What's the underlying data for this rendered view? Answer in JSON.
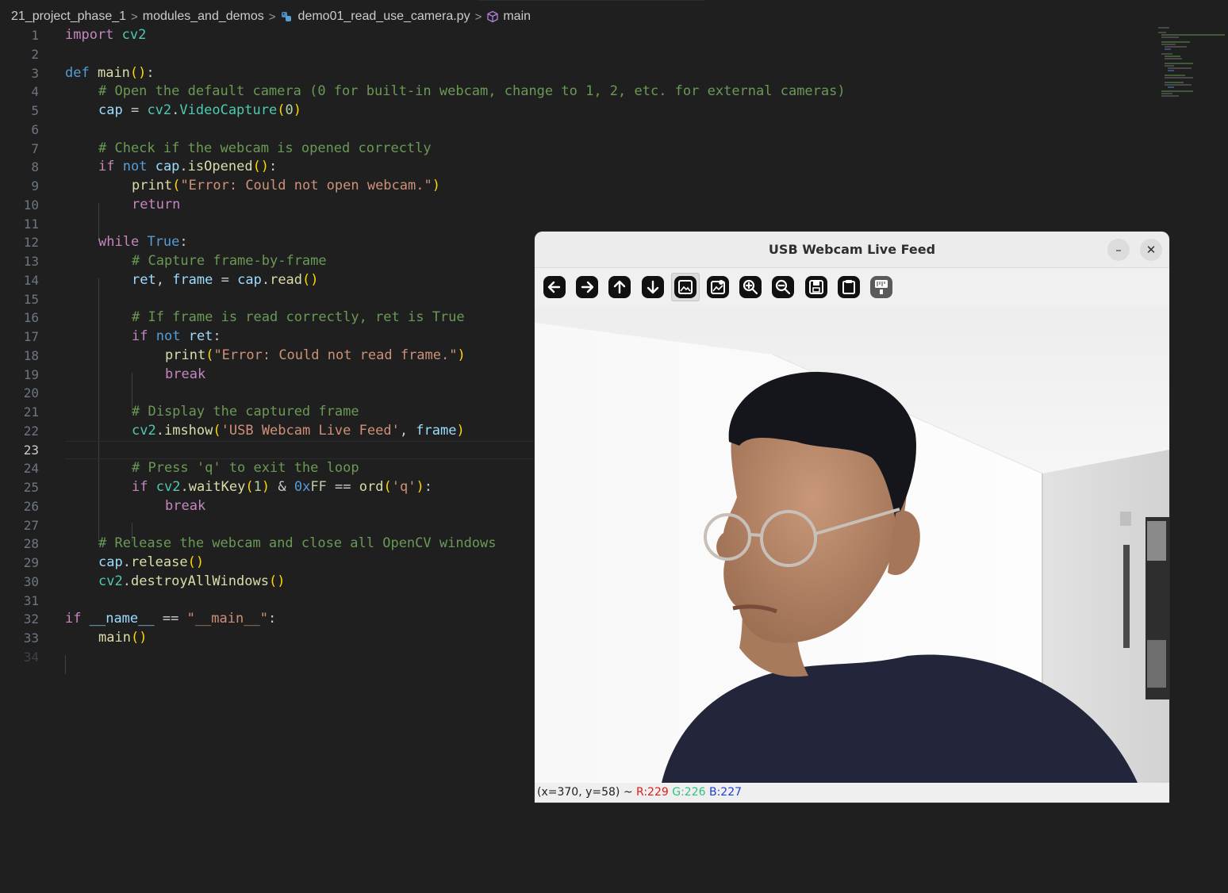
{
  "breadcrumb": {
    "items": [
      "21_project_phase_1",
      "modules_and_demos",
      "demo01_read_use_camera.py",
      "main"
    ],
    "separator": ">"
  },
  "editor": {
    "active_line": 23,
    "line_numbers": [
      "1",
      "2",
      "3",
      "4",
      "5",
      "6",
      "7",
      "8",
      "9",
      "10",
      "11",
      "12",
      "13",
      "14",
      "15",
      "16",
      "17",
      "18",
      "19",
      "20",
      "21",
      "22",
      "23",
      "24",
      "25",
      "26",
      "27",
      "28",
      "29",
      "30",
      "31",
      "32",
      "33",
      "34"
    ],
    "code": {
      "l1_kw": "import",
      "l1_mod": "cv2",
      "l3_kw": "def",
      "l3_fn": "main",
      "l3_paren": "()",
      "l3_colon": ":",
      "l4_cmt": "# Open the default camera (0 for built-in webcam, change to 1, 2, etc. for external cameras)",
      "l5_var": "cap",
      "l5_eq": " = ",
      "l5_mod": "cv2",
      "l5_dot": ".",
      "l5_fn": "VideoCapture",
      "l5_po": "(",
      "l5_num": "0",
      "l5_pc": ")",
      "l7_cmt": "# Check if the webcam is opened correctly",
      "l8_kw": "if",
      "l8_not": "not",
      "l8_var": "cap",
      "l8_dot": ".",
      "l8_fn": "isOpened",
      "l8_paren": "()",
      "l8_colon": ":",
      "l9_fn": "print",
      "l9_po": "(",
      "l9_str": "\"Error: Could not open webcam.\"",
      "l9_pc": ")",
      "l10_kw": "return",
      "l12_kw": "while",
      "l12_true": "True",
      "l12_colon": ":",
      "l13_cmt": "# Capture frame-by-frame",
      "l14_var1": "ret",
      "l14_comma": ", ",
      "l14_var2": "frame",
      "l14_eq": " = ",
      "l14_var3": "cap",
      "l14_dot": ".",
      "l14_fn": "read",
      "l14_paren": "()",
      "l16_cmt": "# If frame is read correctly, ret is True",
      "l17_kw": "if",
      "l17_not": "not",
      "l17_var": "ret",
      "l17_colon": ":",
      "l18_fn": "print",
      "l18_po": "(",
      "l18_str": "\"Error: Could not read frame.\"",
      "l18_pc": ")",
      "l19_kw": "break",
      "l21_cmt": "# Display the captured frame",
      "l22_mod": "cv2",
      "l22_dot": ".",
      "l22_fn": "imshow",
      "l22_po": "(",
      "l22_str": "'USB Webcam Live Feed'",
      "l22_comma": ", ",
      "l22_var": "frame",
      "l22_pc": ")",
      "l24_cmt": "# Press 'q' to exit the loop",
      "l25_kw": "if",
      "l25_mod": "cv2",
      "l25_dot": ".",
      "l25_fn": "waitKey",
      "l25_po": "(",
      "l25_num": "1",
      "l25_pc": ")",
      "l25_amp": " & ",
      "l25_hex0": "0x",
      "l25_hexF": "FF",
      "l25_eq": " == ",
      "l25_fn2": "ord",
      "l25_po2": "(",
      "l25_str": "'q'",
      "l25_pc2": ")",
      "l25_colon": ":",
      "l26_kw": "break",
      "l28_cmt": "# Release the webcam and close all OpenCV windows",
      "l29_var": "cap",
      "l29_dot": ".",
      "l29_fn": "release",
      "l29_paren": "()",
      "l30_mod": "cv2",
      "l30_dot": ".",
      "l30_fn": "destroyAllWindows",
      "l30_paren": "()",
      "l32_kw": "if",
      "l32_var": "__name__",
      "l32_eq": " == ",
      "l32_str": "\"__main__\"",
      "l32_colon": ":",
      "l33_fn": "main",
      "l33_paren": "()"
    }
  },
  "webcam_window": {
    "title": "USB Webcam Live Feed",
    "minimize_label": "–",
    "close_label": "✕",
    "toolbar": [
      "arrow-left-icon",
      "arrow-right-icon",
      "arrow-up-icon",
      "arrow-down-icon",
      "image-icon",
      "image-settings-icon",
      "zoom-in-icon",
      "zoom-out-icon",
      "save-icon",
      "clipboard-icon",
      "properties-icon"
    ],
    "status": {
      "coords": "(x=370, y=58) ~ ",
      "r": "R:229",
      "g": "G:226",
      "b": "B:227"
    }
  },
  "colors": {
    "editor_bg": "#1f1f1f",
    "keyword": "#c586c0",
    "comment": "#6a9955",
    "string": "#ce9178",
    "function": "#dcdcaa"
  }
}
